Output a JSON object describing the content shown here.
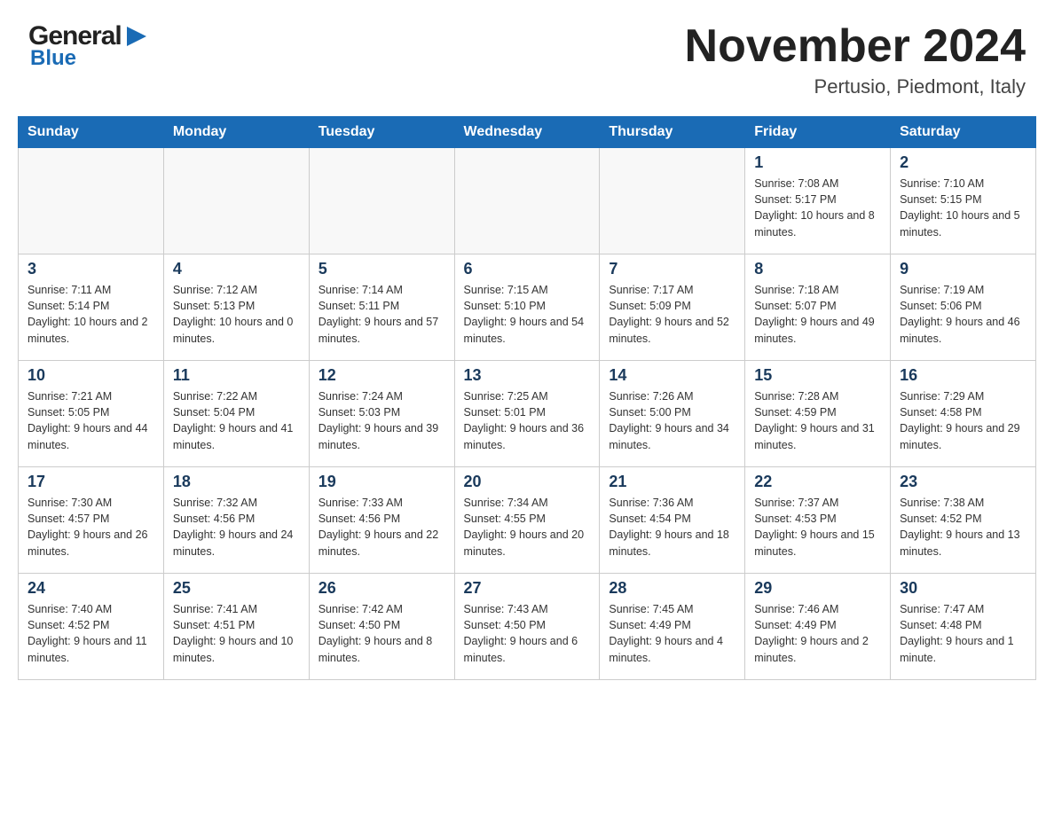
{
  "header": {
    "logo_general": "General",
    "logo_blue": "Blue",
    "title": "November 2024",
    "subtitle": "Pertusio, Piedmont, Italy"
  },
  "calendar": {
    "days_of_week": [
      "Sunday",
      "Monday",
      "Tuesday",
      "Wednesday",
      "Thursday",
      "Friday",
      "Saturday"
    ],
    "weeks": [
      [
        {
          "day": "",
          "info": ""
        },
        {
          "day": "",
          "info": ""
        },
        {
          "day": "",
          "info": ""
        },
        {
          "day": "",
          "info": ""
        },
        {
          "day": "",
          "info": ""
        },
        {
          "day": "1",
          "info": "Sunrise: 7:08 AM\nSunset: 5:17 PM\nDaylight: 10 hours and 8 minutes."
        },
        {
          "day": "2",
          "info": "Sunrise: 7:10 AM\nSunset: 5:15 PM\nDaylight: 10 hours and 5 minutes."
        }
      ],
      [
        {
          "day": "3",
          "info": "Sunrise: 7:11 AM\nSunset: 5:14 PM\nDaylight: 10 hours and 2 minutes."
        },
        {
          "day": "4",
          "info": "Sunrise: 7:12 AM\nSunset: 5:13 PM\nDaylight: 10 hours and 0 minutes."
        },
        {
          "day": "5",
          "info": "Sunrise: 7:14 AM\nSunset: 5:11 PM\nDaylight: 9 hours and 57 minutes."
        },
        {
          "day": "6",
          "info": "Sunrise: 7:15 AM\nSunset: 5:10 PM\nDaylight: 9 hours and 54 minutes."
        },
        {
          "day": "7",
          "info": "Sunrise: 7:17 AM\nSunset: 5:09 PM\nDaylight: 9 hours and 52 minutes."
        },
        {
          "day": "8",
          "info": "Sunrise: 7:18 AM\nSunset: 5:07 PM\nDaylight: 9 hours and 49 minutes."
        },
        {
          "day": "9",
          "info": "Sunrise: 7:19 AM\nSunset: 5:06 PM\nDaylight: 9 hours and 46 minutes."
        }
      ],
      [
        {
          "day": "10",
          "info": "Sunrise: 7:21 AM\nSunset: 5:05 PM\nDaylight: 9 hours and 44 minutes."
        },
        {
          "day": "11",
          "info": "Sunrise: 7:22 AM\nSunset: 5:04 PM\nDaylight: 9 hours and 41 minutes."
        },
        {
          "day": "12",
          "info": "Sunrise: 7:24 AM\nSunset: 5:03 PM\nDaylight: 9 hours and 39 minutes."
        },
        {
          "day": "13",
          "info": "Sunrise: 7:25 AM\nSunset: 5:01 PM\nDaylight: 9 hours and 36 minutes."
        },
        {
          "day": "14",
          "info": "Sunrise: 7:26 AM\nSunset: 5:00 PM\nDaylight: 9 hours and 34 minutes."
        },
        {
          "day": "15",
          "info": "Sunrise: 7:28 AM\nSunset: 4:59 PM\nDaylight: 9 hours and 31 minutes."
        },
        {
          "day": "16",
          "info": "Sunrise: 7:29 AM\nSunset: 4:58 PM\nDaylight: 9 hours and 29 minutes."
        }
      ],
      [
        {
          "day": "17",
          "info": "Sunrise: 7:30 AM\nSunset: 4:57 PM\nDaylight: 9 hours and 26 minutes."
        },
        {
          "day": "18",
          "info": "Sunrise: 7:32 AM\nSunset: 4:56 PM\nDaylight: 9 hours and 24 minutes."
        },
        {
          "day": "19",
          "info": "Sunrise: 7:33 AM\nSunset: 4:56 PM\nDaylight: 9 hours and 22 minutes."
        },
        {
          "day": "20",
          "info": "Sunrise: 7:34 AM\nSunset: 4:55 PM\nDaylight: 9 hours and 20 minutes."
        },
        {
          "day": "21",
          "info": "Sunrise: 7:36 AM\nSunset: 4:54 PM\nDaylight: 9 hours and 18 minutes."
        },
        {
          "day": "22",
          "info": "Sunrise: 7:37 AM\nSunset: 4:53 PM\nDaylight: 9 hours and 15 minutes."
        },
        {
          "day": "23",
          "info": "Sunrise: 7:38 AM\nSunset: 4:52 PM\nDaylight: 9 hours and 13 minutes."
        }
      ],
      [
        {
          "day": "24",
          "info": "Sunrise: 7:40 AM\nSunset: 4:52 PM\nDaylight: 9 hours and 11 minutes."
        },
        {
          "day": "25",
          "info": "Sunrise: 7:41 AM\nSunset: 4:51 PM\nDaylight: 9 hours and 10 minutes."
        },
        {
          "day": "26",
          "info": "Sunrise: 7:42 AM\nSunset: 4:50 PM\nDaylight: 9 hours and 8 minutes."
        },
        {
          "day": "27",
          "info": "Sunrise: 7:43 AM\nSunset: 4:50 PM\nDaylight: 9 hours and 6 minutes."
        },
        {
          "day": "28",
          "info": "Sunrise: 7:45 AM\nSunset: 4:49 PM\nDaylight: 9 hours and 4 minutes."
        },
        {
          "day": "29",
          "info": "Sunrise: 7:46 AM\nSunset: 4:49 PM\nDaylight: 9 hours and 2 minutes."
        },
        {
          "day": "30",
          "info": "Sunrise: 7:47 AM\nSunset: 4:48 PM\nDaylight: 9 hours and 1 minute."
        }
      ]
    ]
  }
}
